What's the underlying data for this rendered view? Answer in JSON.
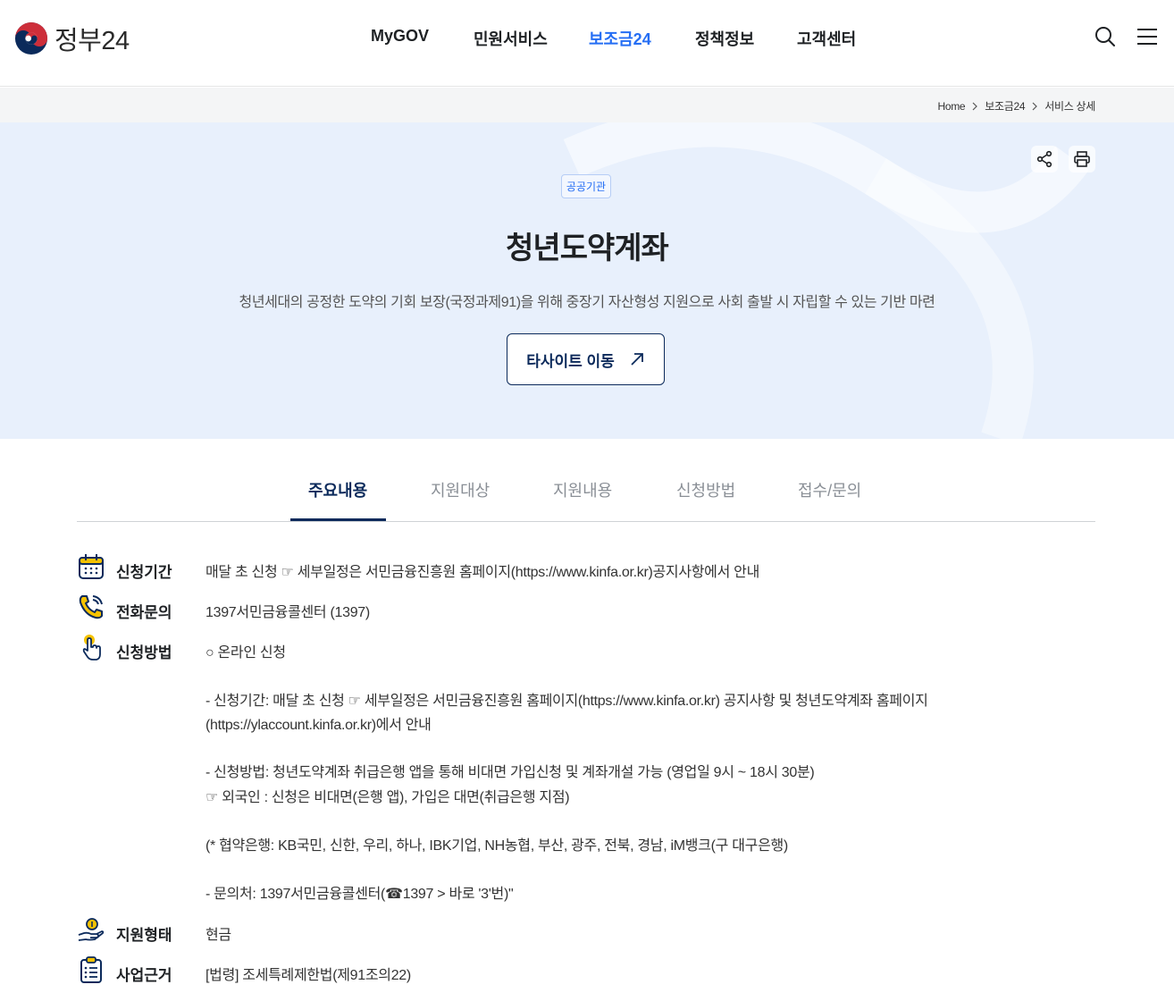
{
  "header": {
    "logo_text": "정부24",
    "nav": [
      "MyGOV",
      "민원서비스",
      "보조금24",
      "정책정보",
      "고객센터"
    ],
    "active_nav": "보조금24"
  },
  "breadcrumb": [
    "Home",
    "보조금24",
    "서비스 상세"
  ],
  "hero": {
    "badge": "공공기관",
    "title": "청년도약계좌",
    "description": "청년세대의 공정한 도약의 기회 보장(국정과제91)을 위해 중장기 자산형성 지원으로 사회 출발 시 자립할 수 있는 기반 마련",
    "button_label": "타사이트 이동"
  },
  "tabs": [
    "주요내용",
    "지원대상",
    "지원내용",
    "신청방법",
    "접수/문의"
  ],
  "info": {
    "period": {
      "label": "신청기간",
      "value": "매달 초 신청 ☞ 세부일정은 서민금융진흥원 홈페이지(https://www.kinfa.or.kr)공지사항에서 안내"
    },
    "phone": {
      "label": "전화문의",
      "value": "1397서민금융콜센터 (1397)"
    },
    "method": {
      "label": "신청방법",
      "lines": [
        "○ 온라인 신청",
        "- 신청기간: 매달 초 신청 ☞ 세부일정은 서민금융진흥원 홈페이지(https://www.kinfa.or.kr) 공지사항 및 청년도약계좌 홈페이지",
        "(https://ylaccount.kinfa.or.kr)에서 안내",
        "- 신청방법: 청년도약계좌 취급은행 앱을 통해 비대면 가입신청 및 계좌개설 가능 (영업일 9시 ~ 18시 30분)",
        "☞ 외국인 : 신청은 비대면(은행 앱), 가입은 대면(취급은행 지점)",
        "(* 협약은행: KB국민, 신한, 우리, 하나, IBK기업, NH농협, 부산, 광주, 전북, 경남, iM뱅크(구 대구은행)",
        "- 문의처: 1397서민금융콜센터(☎1397 > 바로 '3'번)\""
      ]
    },
    "support_type": {
      "label": "지원형태",
      "value": "현금"
    },
    "legal_basis": {
      "label": "사업근거",
      "value": "[법령] 조세특례제한법(제91조의22)"
    }
  },
  "icons": {
    "accent": "#256ef4",
    "navy": "#0b2a5b",
    "yellow": "#f5c200"
  }
}
